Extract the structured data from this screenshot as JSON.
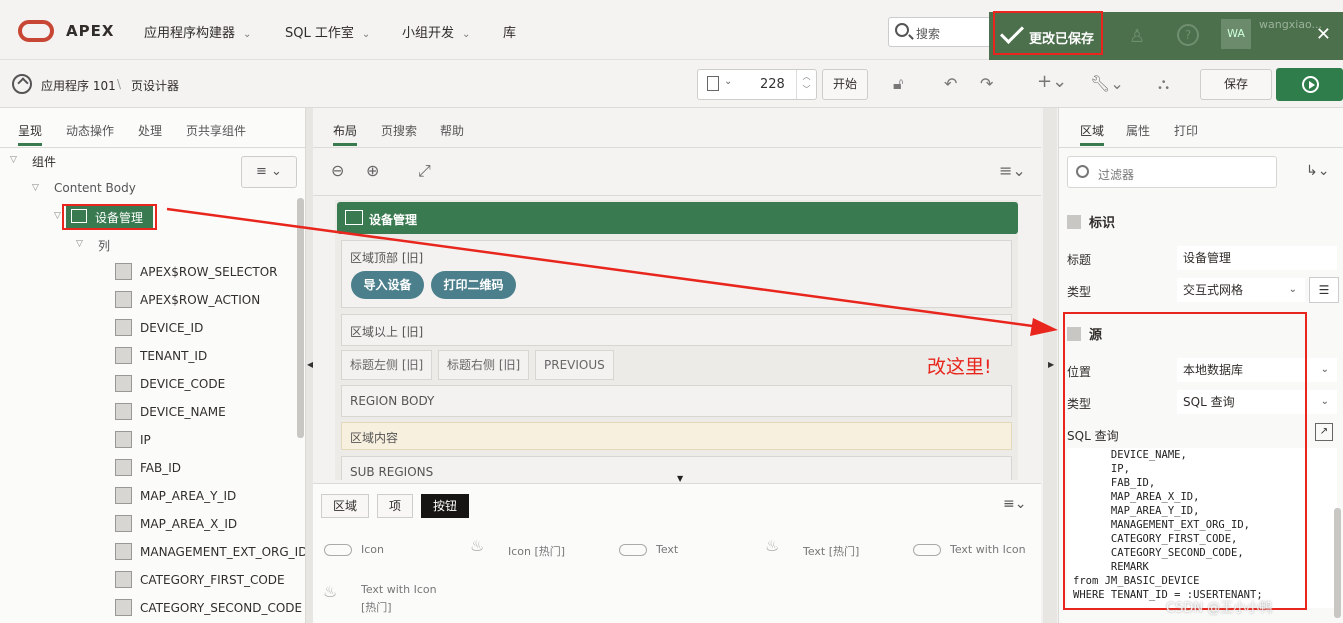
{
  "topbar": {
    "brand": "APEX",
    "nav": [
      "应用程序构建器",
      "SQL 工作室",
      "小组开发",
      "库"
    ],
    "search_placeholder": "搜索",
    "toast_message": "更改已保存",
    "avatar": "WA",
    "user": "wangxiao..."
  },
  "toolbar": {
    "breadcrumb_app": "应用程序 101",
    "breadcrumb_sep": "\\",
    "breadcrumb_page": "页设计器",
    "page_number": "228",
    "go_label": "开始",
    "save_label": "保存"
  },
  "left": {
    "tabs": [
      "呈现",
      "动态操作",
      "处理",
      "页共享组件"
    ],
    "components_label": "组件",
    "content_body": "Content Body",
    "selected_region": "设备管理",
    "columns_label": "列",
    "columns": [
      "APEX$ROW_SELECTOR",
      "APEX$ROW_ACTION",
      "DEVICE_ID",
      "TENANT_ID",
      "DEVICE_CODE",
      "DEVICE_NAME",
      "IP",
      "FAB_ID",
      "MAP_AREA_Y_ID",
      "MAP_AREA_X_ID",
      "MANAGEMENT_EXT_ORG_ID",
      "CATEGORY_FIRST_CODE",
      "CATEGORY_SECOND_CODE"
    ]
  },
  "middle": {
    "tabs": [
      "布局",
      "页搜索",
      "帮助"
    ],
    "region_title": "设备管理",
    "region_top": "区域顶部 [旧]",
    "btn_import": "导入设备",
    "btn_print": "打印二维码",
    "region_above": "区域以上 [旧]",
    "title_left": "标题左侧 [旧]",
    "title_right": "标题右侧 [旧]",
    "previous": "PREVIOUS",
    "region_body": "REGION BODY",
    "region_content": "区域内容",
    "sub_regions": "SUB REGIONS",
    "annotation": "改这里!",
    "gallery_tabs": [
      "区域",
      "项",
      "按钮"
    ],
    "gallery_items": [
      "Icon",
      "Icon [热门]",
      "Text",
      "Text [热门]",
      "Text with Icon",
      "Text with Icon",
      "[热门]"
    ]
  },
  "right": {
    "tabs": [
      "区域",
      "属性",
      "打印"
    ],
    "filter_placeholder": "过滤器",
    "section_identify": "标识",
    "title_label": "标题",
    "title_value": "设备管理",
    "type_label": "类型",
    "type_value": "交互式网格",
    "section_source": "源",
    "location_label": "位置",
    "location_value": "本地数据库",
    "source_type_label": "类型",
    "source_type_value": "SQL 查询",
    "sql_label": "SQL 查询",
    "sql_lines": [
      "      DEVICE_NAME,",
      "      IP,",
      "      FAB_ID,",
      "      MAP_AREA_X_ID,",
      "      MAP_AREA_Y_ID,",
      "      MANAGEMENT_EXT_ORG_ID,",
      "      CATEGORY_FIRST_CODE,",
      "      CATEGORY_SECOND_CODE,",
      "      REMARK",
      "from JM_BASIC_DEVICE",
      "WHERE TENANT_ID = :USERTENANT;"
    ]
  },
  "watermark": "CSDN @王小小鸭",
  "colors": {
    "accent": "#3a7a51",
    "annotation": "#e8261d",
    "toast": "#4c6f4c",
    "oracle_red": "#c74634"
  }
}
